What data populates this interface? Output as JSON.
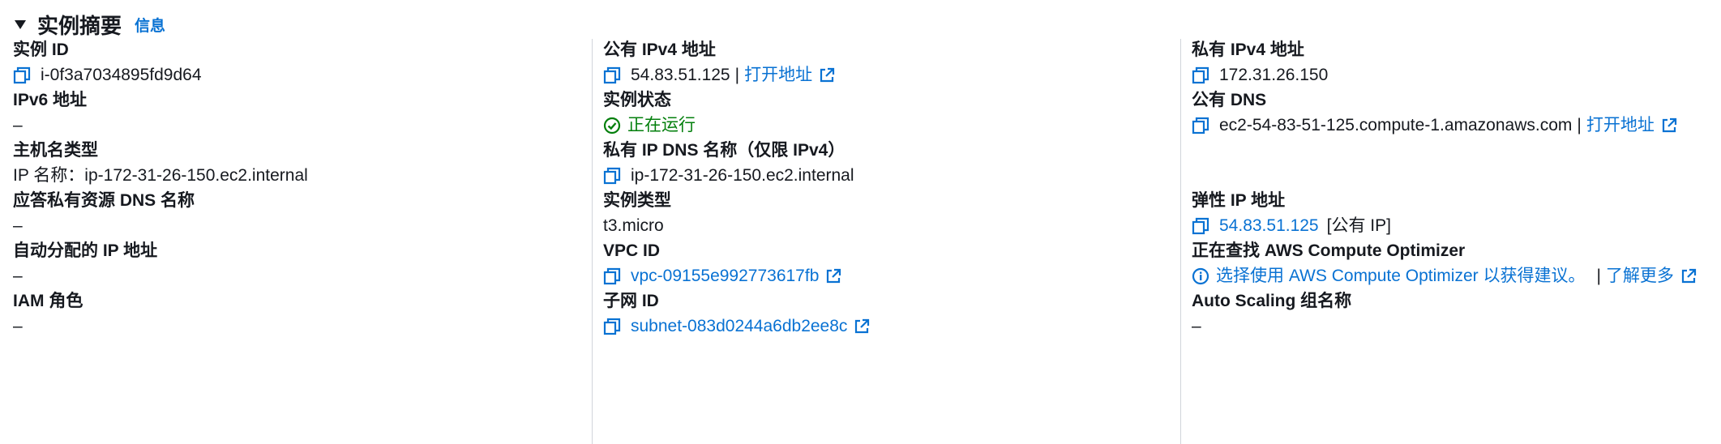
{
  "header": {
    "title": "实例摘要",
    "info": "信息"
  },
  "fields": {
    "instance_id": {
      "label": "实例 ID",
      "value": "i-0f3a7034895fd9d64"
    },
    "ipv6": {
      "label": "IPv6 地址",
      "value": "–"
    },
    "hostname_type": {
      "label": "主机名类型",
      "value": "IP 名称：ip-172-31-26-150.ec2.internal"
    },
    "answer_private_dns": {
      "label": "应答私有资源 DNS 名称",
      "value": "–"
    },
    "auto_ip": {
      "label": "自动分配的 IP 地址",
      "value": "–"
    },
    "iam_role": {
      "label": "IAM 角色",
      "value": "–"
    },
    "public_ipv4": {
      "label": "公有 IPv4 地址",
      "value": "54.83.51.125",
      "sep": "|",
      "link": "打开地址"
    },
    "state": {
      "label": "实例状态",
      "value": "正在运行"
    },
    "private_ip_dns": {
      "label": "私有 IP DNS 名称（仅限 IPv4）",
      "value": "ip-172-31-26-150.ec2.internal"
    },
    "instance_type": {
      "label": "实例类型",
      "value": "t3.micro"
    },
    "vpc": {
      "label": "VPC ID",
      "value": "vpc-09155e992773617fb"
    },
    "subnet": {
      "label": "子网 ID",
      "value": "subnet-083d0244a6db2ee8c"
    },
    "private_ipv4": {
      "label": "私有 IPv4 地址",
      "value": "172.31.26.150"
    },
    "public_dns": {
      "label": "公有 DNS",
      "value": "ec2-54-83-51-125.compute-1.amazonaws.com",
      "sep": "|",
      "link": "打开地址"
    },
    "elastic_ip": {
      "label": "弹性 IP 地址",
      "value": "54.83.51.125",
      "suffix": "[公有 IP]"
    },
    "optimizer": {
      "label": "正在查找 AWS Compute Optimizer",
      "value": "选择使用 AWS Compute Optimizer 以获得建议。",
      "sep": "|",
      "link": "了解更多"
    },
    "asg": {
      "label": "Auto Scaling 组名称",
      "value": "–"
    }
  },
  "colors": {
    "link": "#0972d3",
    "success": "#037f0c",
    "text": "#16191f",
    "divider": "#d1d5db"
  },
  "icons": [
    "caret-down-icon",
    "copy-icon",
    "external-link-icon",
    "status-success-icon",
    "info-circle-icon"
  ]
}
